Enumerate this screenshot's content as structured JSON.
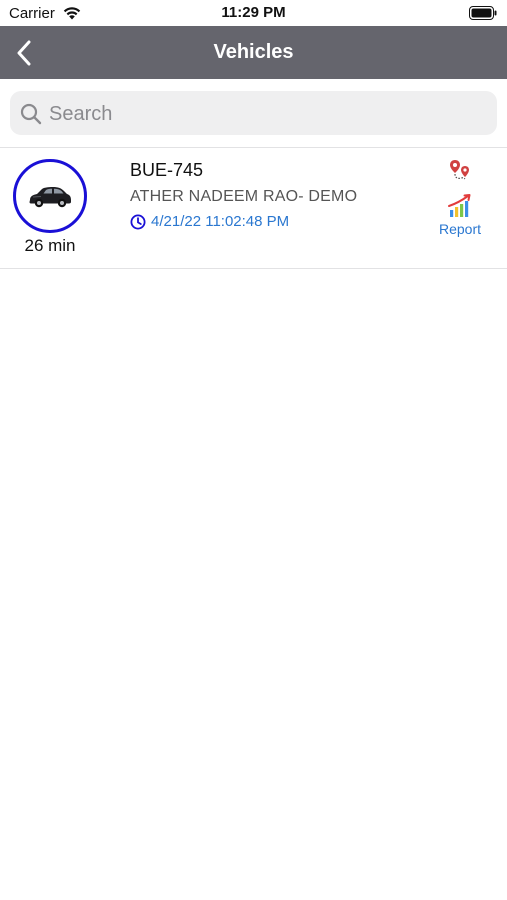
{
  "status_bar": {
    "carrier": "Carrier",
    "time": "11:29 PM",
    "wifi_icon": "wifi-icon",
    "battery_icon": "battery-icon"
  },
  "nav": {
    "title": "Vehicles",
    "back_icon": "chevron-left-icon",
    "background_color": "#65656d"
  },
  "search": {
    "placeholder": "Search",
    "value": "",
    "icon": "search-icon"
  },
  "vehicles": [
    {
      "plate": "BUE-745",
      "owner": "ATHER NADEEM RAO- DEMO",
      "timestamp": "4/21/22 11:02:48 PM",
      "duration": "26 min",
      "avatar_icon": "car-icon",
      "ring_color": "#1a10d6",
      "route_icon": "route-pins-icon",
      "report_icon": "bar-chart-icon",
      "report_label": "Report"
    }
  ],
  "colors": {
    "accent_blue": "#2a77d0",
    "ring_blue": "#1a10d6"
  }
}
